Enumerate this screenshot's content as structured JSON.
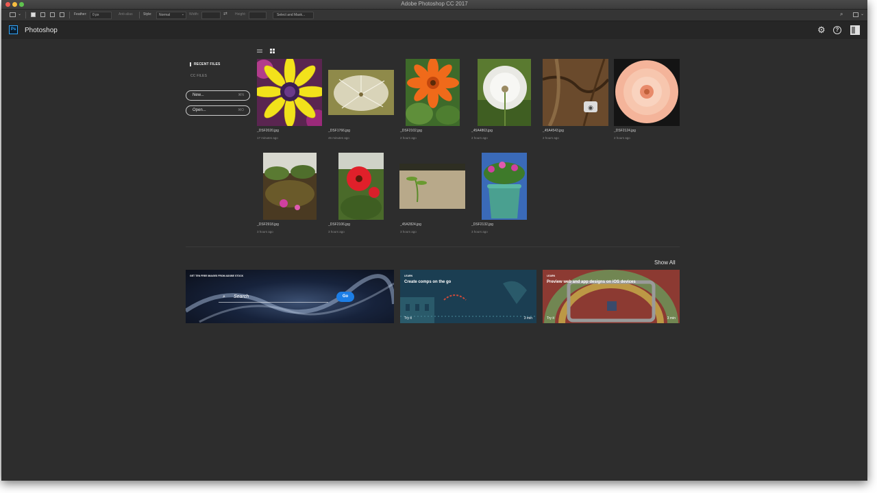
{
  "window": {
    "title": "Adobe Photoshop CC 2017"
  },
  "options_bar": {
    "feather_label": "Feather:",
    "feather_value": "0 px",
    "anti_alias_label": "Anti-alias",
    "style_label": "Style:",
    "style_value": "Normal",
    "width_label": "Width:",
    "height_label": "Height:",
    "select_mask_label": "Select and Mask..."
  },
  "app": {
    "logo": "Ps",
    "name": "Photoshop"
  },
  "header_icons": [
    "gear-icon",
    "help-icon",
    "panels-icon"
  ],
  "sidebar": {
    "recent_label": "RECENT FILES",
    "cc_label": "CC FILES",
    "new_label": "New...",
    "new_shortcut": "⌘N",
    "open_label": "Open...",
    "open_shortcut": "⌘O"
  },
  "files": [
    {
      "name": "_DSF2020.jpg",
      "time": "17 minutes ago"
    },
    {
      "name": "_DSF1766.jpg",
      "time": "45 minutes ago"
    },
    {
      "name": "_DSF2102.jpg",
      "time": "2 hours ago"
    },
    {
      "name": "_45A4863.jpg",
      "time": "2 hours ago"
    },
    {
      "name": "_45A4543.jpg",
      "time": "2 hours ago"
    },
    {
      "name": "_DSF2124.jpg",
      "time": "2 hours ago"
    },
    {
      "name": "_DSF2918.jpg",
      "time": "3 hours ago"
    },
    {
      "name": "_DSF2106.jpg",
      "time": "3 hours ago"
    },
    {
      "name": "_45A2824.jpg",
      "time": "3 hours ago"
    },
    {
      "name": "_DSF2132.jpg",
      "time": "3 hours ago"
    }
  ],
  "show_all_label": "Show All",
  "stock_card": {
    "title": "GET TEN FREE IMAGES FROM ADOBE STOCK",
    "search_placeholder": "Search",
    "go_label": "Go"
  },
  "learn_cards": [
    {
      "tag": "LEARN",
      "title": "Create comps on the go",
      "try_label": "Try it",
      "duration": "3 min"
    },
    {
      "tag": "LEARN",
      "title": "Preview web and app designs on iOS devices",
      "try_label": "Try it",
      "duration": "3 min"
    }
  ],
  "colors": {
    "accent": "#31a8ff",
    "go_button": "#1c7ee6",
    "background": "#2d2d2d"
  }
}
